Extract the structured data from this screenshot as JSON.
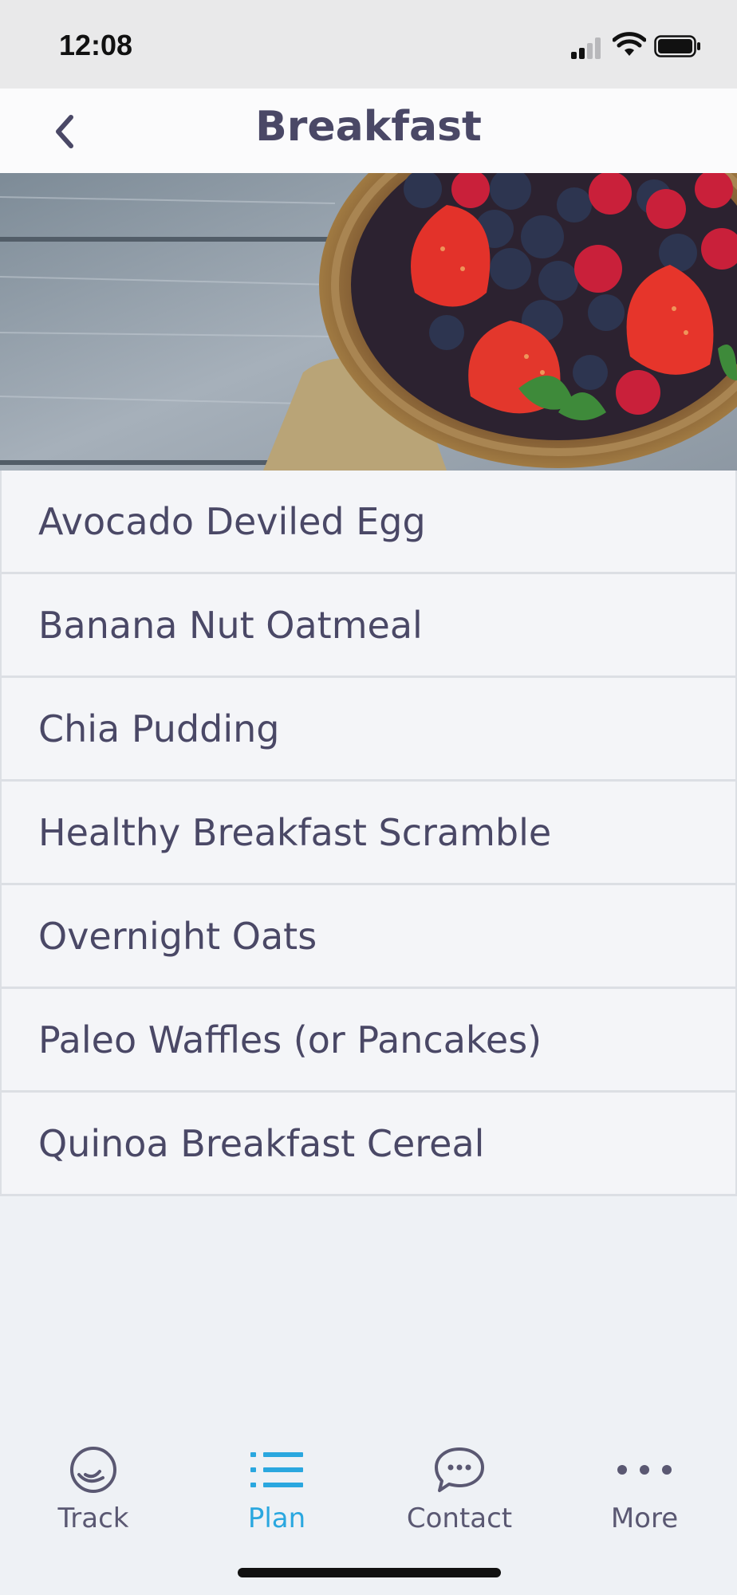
{
  "status_bar": {
    "time": "12:08"
  },
  "nav": {
    "title": "Breakfast",
    "back_icon": "chevron-left-icon"
  },
  "hero": {
    "image": "berries-basket-on-wooden-table"
  },
  "recipes": [
    {
      "label": "Avocado Deviled Egg"
    },
    {
      "label": "Banana Nut Oatmeal"
    },
    {
      "label": "Chia Pudding"
    },
    {
      "label": "Healthy Breakfast Scramble"
    },
    {
      "label": "Overnight Oats"
    },
    {
      "label": "Paleo Waffles (or Pancakes)"
    },
    {
      "label": "Quinoa Breakfast Cereal"
    }
  ],
  "tabs": [
    {
      "label": "Track",
      "icon": "track-icon",
      "active": false
    },
    {
      "label": "Plan",
      "icon": "list-icon",
      "active": true
    },
    {
      "label": "Contact",
      "icon": "chat-bubble-icon",
      "active": false
    },
    {
      "label": "More",
      "icon": "more-dots-icon",
      "active": false
    }
  ],
  "colors": {
    "accent": "#2aa7df",
    "text": "#4a4866",
    "background": "#eef1f5"
  }
}
